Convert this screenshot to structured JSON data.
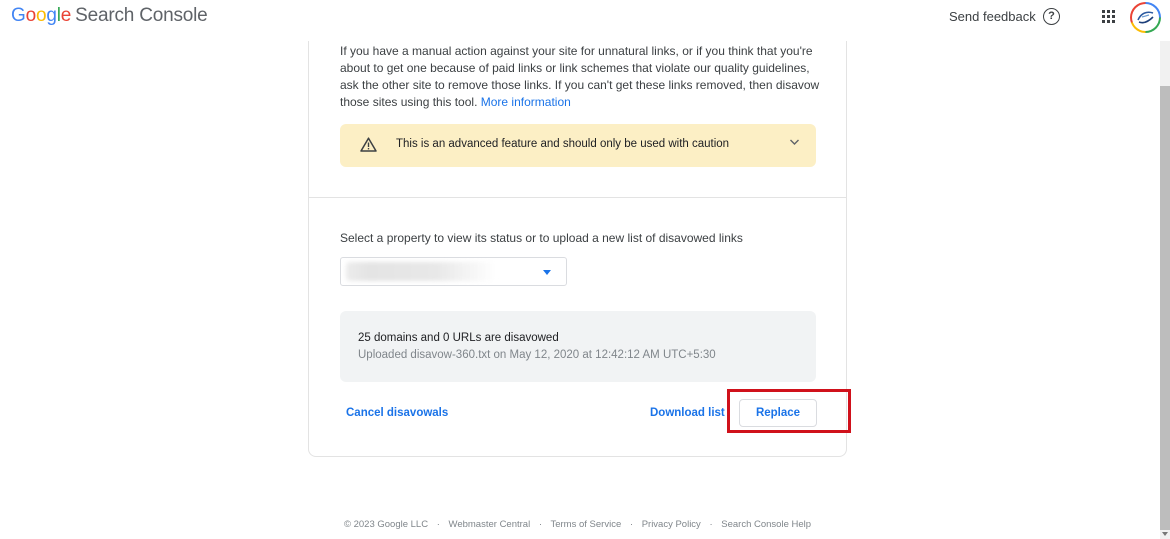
{
  "header": {
    "logo": {
      "g1": "G",
      "o1": "o",
      "o2": "o",
      "g2": "g",
      "l": "l",
      "e": "e",
      "product": "Search Console"
    },
    "send_feedback": "Send feedback",
    "help_icon": "?",
    "apps_icon": "apps-grid-icon",
    "avatar_icon": "account-avatar"
  },
  "intro": {
    "text": "If you have a manual action against your site for unnatural links, or if you think that you're about to get one because of paid links or link schemes that violate our quality guidelines, ask the other site to remove those links. If you can't get these links removed, then disavow those sites using this tool. ",
    "link": "More information"
  },
  "warning": {
    "icon": "warning-triangle-icon",
    "text": "This is an advanced feature and should only be used with caution",
    "expanded": false
  },
  "property": {
    "label": "Select a property to view its status or to upload a new list of disavowed links",
    "selected_value": ""
  },
  "status": {
    "title": "25 domains and 0 URLs are disavowed",
    "subtitle": "Uploaded disavow-360.txt on May 12, 2020 at 12:42:12 AM UTC+5:30"
  },
  "actions": {
    "cancel": "Cancel disavowals",
    "download": "Download list",
    "replace": "Replace"
  },
  "annotation": {
    "highlight_color": "#d0111b",
    "highlighted": "Replace"
  },
  "footer": {
    "copyright": "© 2023 Google LLC",
    "links": [
      "Webmaster Central",
      "Terms of Service",
      "Privacy Policy",
      "Search Console Help"
    ],
    "separator": "·"
  },
  "colors": {
    "accent": "#1a73e8",
    "warning_bg": "#fcefc5",
    "status_bg": "#f1f3f4"
  }
}
